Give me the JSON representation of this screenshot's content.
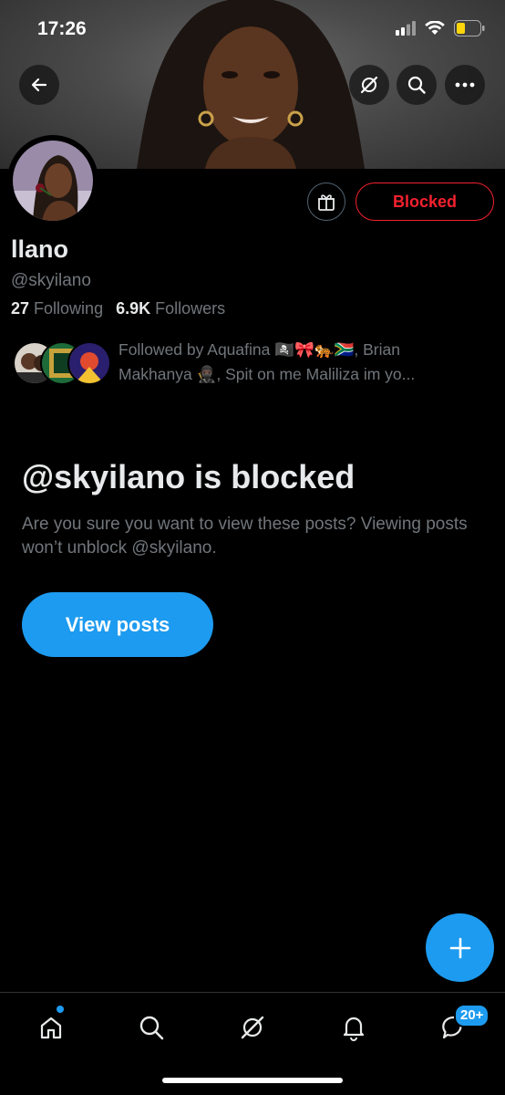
{
  "status_bar": {
    "time": "17:26"
  },
  "profile": {
    "display_name": "llano",
    "handle": "@skyilano",
    "following_count": "27",
    "following_label": "Following",
    "followers_count": "6.9K",
    "followers_label": "Followers",
    "followed_by_line1": "Followed by Aquafina 🏴‍☠️🎀🐅🇿🇦, Brian",
    "followed_by_line2": "Makhanya 🥷🏿, Spit on me Maliliza im yo..."
  },
  "actions": {
    "blocked_label": "Blocked"
  },
  "blocked_notice": {
    "title": "@skyilano is blocked",
    "description": "Are you sure you want to view these posts? Viewing posts won’t unblock @skyilano.",
    "view_button": "View posts"
  },
  "bottom_nav": {
    "items": [
      "home-icon",
      "search-icon",
      "grok-icon",
      "notifications-icon",
      "messages-icon"
    ],
    "messages_badge": "20+"
  },
  "colors": {
    "accent": "#1d9bf0",
    "blocked_red": "#f4212e",
    "muted": "#71767b"
  }
}
